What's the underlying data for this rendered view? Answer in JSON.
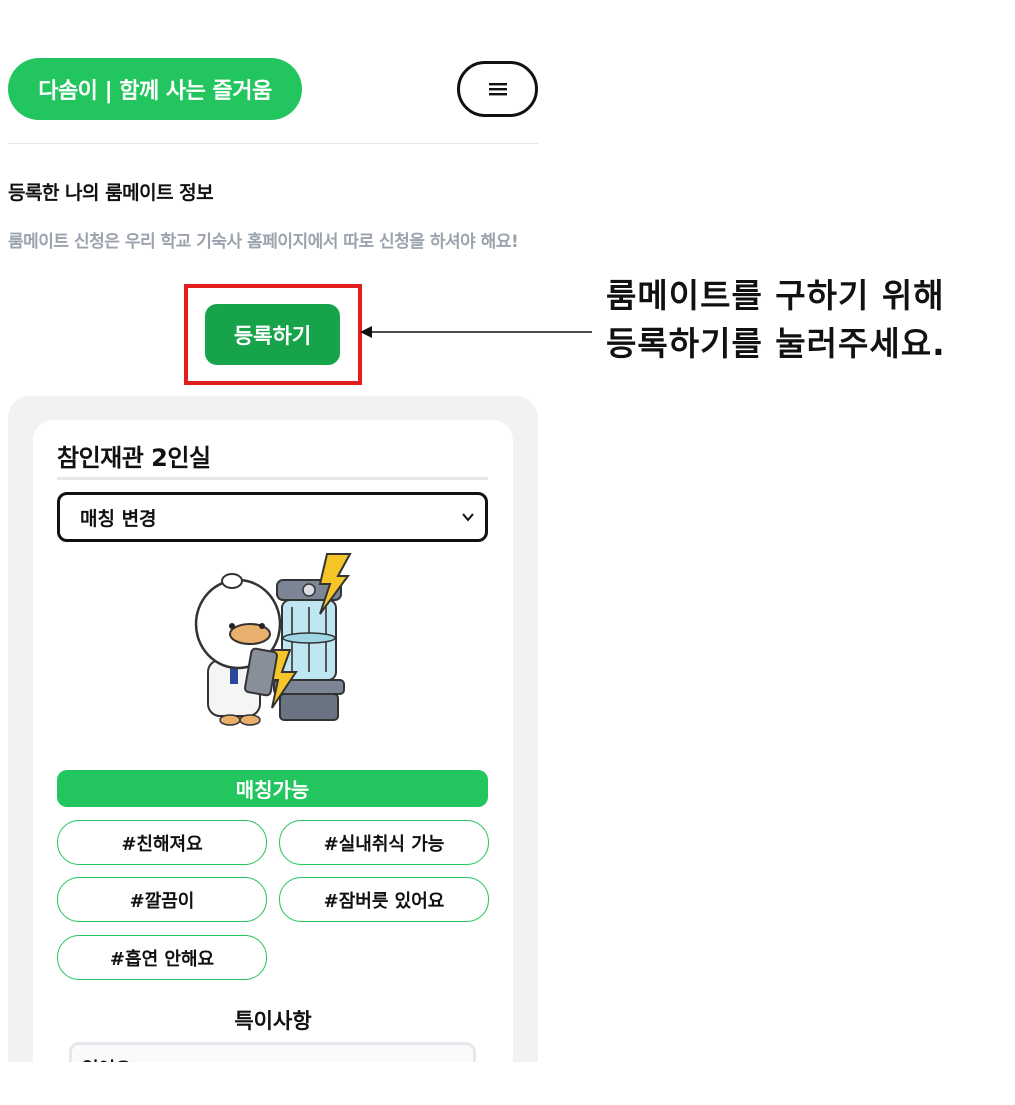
{
  "header": {
    "brand": "다솜이 | 함께 사는 즐거움",
    "menu_icon": "hamburger-icon"
  },
  "section": {
    "title": "등록한 나의 룸메이트 정보",
    "description": "룸메이트 신청은 우리 학교 기숙사 홈페이지에서 따로 신청을 하셔야 해요!",
    "register_label": "등록하기"
  },
  "annotation": {
    "line1": "룸메이트를 구하기 위해",
    "line2": "등록하기를 눌러주세요."
  },
  "card": {
    "room_title": "참인재관 2인실",
    "select_value": "매칭 변경",
    "status": "매칭가능",
    "tags": [
      "#친해져요",
      "#실내취식 가능",
      "#깔끔이",
      "#잠버릇 있어요",
      "#흡연 안해요"
    ],
    "notes_title": "특이사항",
    "notes_value": "없어요"
  },
  "colors": {
    "brand_green": "#22c55e",
    "button_green": "#16a34a",
    "highlight_red": "#e11d1d"
  }
}
